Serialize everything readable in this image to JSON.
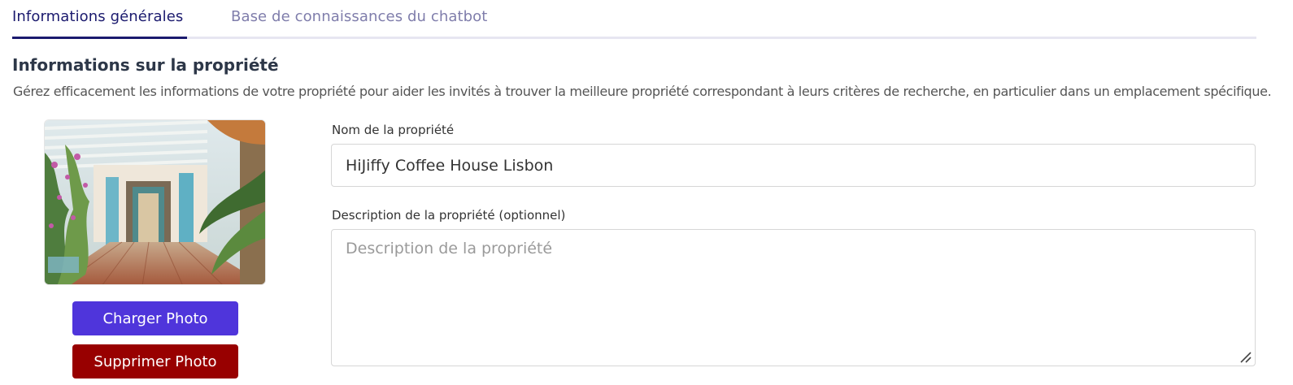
{
  "tabs": [
    {
      "label": "Informations générales",
      "active": true
    },
    {
      "label": "Base de connaissances du chatbot",
      "active": false
    }
  ],
  "section": {
    "title": "Informations sur la propriété",
    "description": "Gérez efficacement les informations de votre propriété pour aider les invités à trouver la meilleure propriété correspondant à leurs critères de recherche, en particulier dans un emplacement spécifique."
  },
  "photo": {
    "upload_label": "Charger Photo",
    "delete_label": "Supprimer Photo"
  },
  "form": {
    "name_label": "Nom de la propriété",
    "name_value": "HiJiffy Coffee House Lisbon",
    "desc_label": "Description de la propriété (optionnel)",
    "desc_placeholder": "Description de la propriété",
    "desc_value": ""
  },
  "colors": {
    "primary": "#4f35db",
    "danger": "#980000",
    "tab_active": "#1b1a6e",
    "tab_inactive": "#7f7dab"
  }
}
